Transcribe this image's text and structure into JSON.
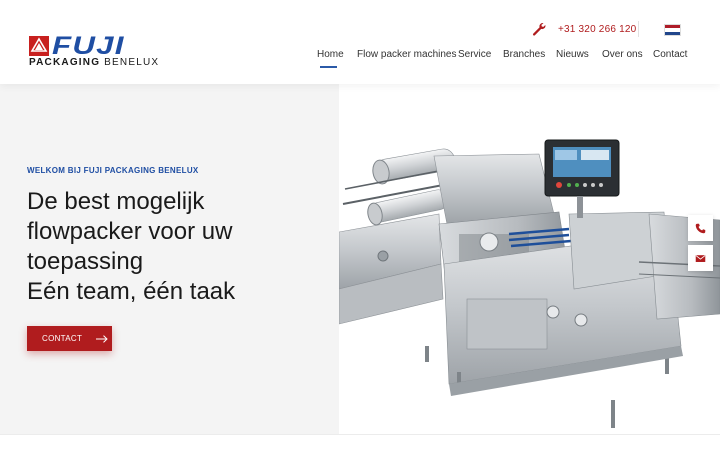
{
  "header": {
    "logo": {
      "brand": "FUJI",
      "subtitle_bold": "PACKAGING",
      "subtitle_rest": "BENELUX"
    },
    "phone": "+31 320 266 120",
    "language_flag": "nl-flag-icon",
    "nav": [
      {
        "label": "Home",
        "active": true
      },
      {
        "label": "Flow packer machines"
      },
      {
        "label": "Service"
      },
      {
        "label": "Branches"
      },
      {
        "label": "Nieuws"
      },
      {
        "label": "Over ons"
      },
      {
        "label": "Contact"
      }
    ]
  },
  "hero": {
    "eyebrow": "WELKOM BIJ FUJI PACKAGING BENELUX",
    "headline": [
      "De best mogelijk",
      "flowpacker voor uw",
      "toepassing",
      "Eén team, één taak"
    ],
    "cta_label": "CONTACT",
    "cta_icon": "arrow-right-icon",
    "image": "flow-packer-machine-image"
  },
  "side_buttons": [
    {
      "icon": "phone-icon"
    },
    {
      "icon": "mail-icon"
    }
  ],
  "colors": {
    "brand_blue": "#1f4ea3",
    "brand_red": "#b01c1e",
    "hero_bg": "#f4f4f4"
  }
}
